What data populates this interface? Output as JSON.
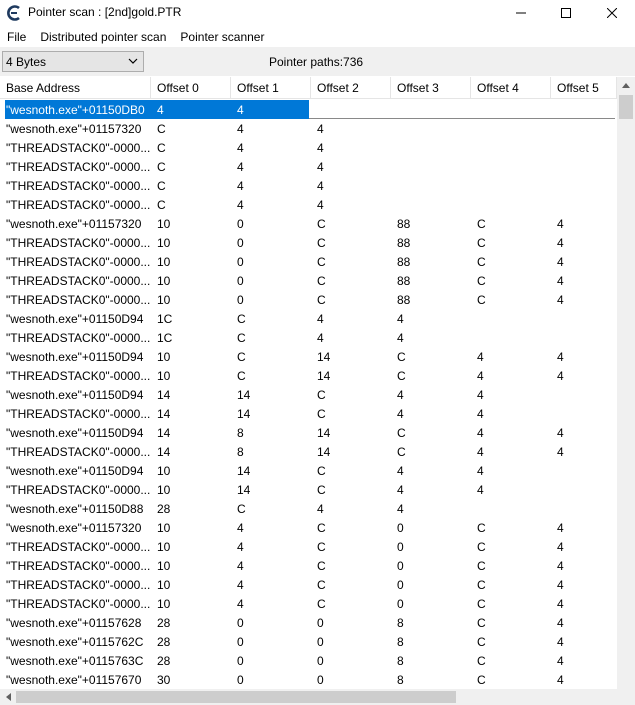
{
  "window": {
    "title": "Pointer scan : [2nd]gold.PTR",
    "minimize_glyph": "—",
    "maximize_glyph": "☐",
    "close_glyph": "✕"
  },
  "menu": [
    "File",
    "Distributed pointer scan",
    "Pointer scanner"
  ],
  "toolbar": {
    "value_type": "4 Bytes",
    "pointer_paths": "Pointer paths:736"
  },
  "table": {
    "columns": [
      "Base Address",
      "Offset 0",
      "Offset 1",
      "Offset 2",
      "Offset 3",
      "Offset 4",
      "Offset 5"
    ],
    "selected_row": 0,
    "rows": [
      [
        "\"wesnoth.exe\"+01150DB0",
        "4",
        "4",
        "",
        "",
        "",
        ""
      ],
      [
        "\"wesnoth.exe\"+01157320",
        "C",
        "4",
        "4",
        "",
        "",
        ""
      ],
      [
        "\"THREADSTACK0\"-0000...",
        "C",
        "4",
        "4",
        "",
        "",
        ""
      ],
      [
        "\"THREADSTACK0\"-0000...",
        "C",
        "4",
        "4",
        "",
        "",
        ""
      ],
      [
        "\"THREADSTACK0\"-0000...",
        "C",
        "4",
        "4",
        "",
        "",
        ""
      ],
      [
        "\"THREADSTACK0\"-0000...",
        "C",
        "4",
        "4",
        "",
        "",
        ""
      ],
      [
        "\"wesnoth.exe\"+01157320",
        "10",
        "0",
        "C",
        "88",
        "C",
        "4"
      ],
      [
        "\"THREADSTACK0\"-0000...",
        "10",
        "0",
        "C",
        "88",
        "C",
        "4"
      ],
      [
        "\"THREADSTACK0\"-0000...",
        "10",
        "0",
        "C",
        "88",
        "C",
        "4"
      ],
      [
        "\"THREADSTACK0\"-0000...",
        "10",
        "0",
        "C",
        "88",
        "C",
        "4"
      ],
      [
        "\"THREADSTACK0\"-0000...",
        "10",
        "0",
        "C",
        "88",
        "C",
        "4"
      ],
      [
        "\"wesnoth.exe\"+01150D94",
        "1C",
        "C",
        "4",
        "4",
        "",
        ""
      ],
      [
        "\"THREADSTACK0\"-0000...",
        "1C",
        "C",
        "4",
        "4",
        "",
        ""
      ],
      [
        "\"wesnoth.exe\"+01150D94",
        "10",
        "C",
        "14",
        "C",
        "4",
        "4"
      ],
      [
        "\"THREADSTACK0\"-0000...",
        "10",
        "C",
        "14",
        "C",
        "4",
        "4"
      ],
      [
        "\"wesnoth.exe\"+01150D94",
        "14",
        "14",
        "C",
        "4",
        "4",
        ""
      ],
      [
        "\"THREADSTACK0\"-0000...",
        "14",
        "14",
        "C",
        "4",
        "4",
        ""
      ],
      [
        "\"wesnoth.exe\"+01150D94",
        "14",
        "8",
        "14",
        "C",
        "4",
        "4"
      ],
      [
        "\"THREADSTACK0\"-0000...",
        "14",
        "8",
        "14",
        "C",
        "4",
        "4"
      ],
      [
        "\"wesnoth.exe\"+01150D94",
        "10",
        "14",
        "C",
        "4",
        "4",
        ""
      ],
      [
        "\"THREADSTACK0\"-0000...",
        "10",
        "14",
        "C",
        "4",
        "4",
        ""
      ],
      [
        "\"wesnoth.exe\"+01150D88",
        "28",
        "C",
        "4",
        "4",
        "",
        ""
      ],
      [
        "\"wesnoth.exe\"+01157320",
        "10",
        "4",
        "C",
        "0",
        "C",
        "4"
      ],
      [
        "\"THREADSTACK0\"-0000...",
        "10",
        "4",
        "C",
        "0",
        "C",
        "4"
      ],
      [
        "\"THREADSTACK0\"-0000...",
        "10",
        "4",
        "C",
        "0",
        "C",
        "4"
      ],
      [
        "\"THREADSTACK0\"-0000...",
        "10",
        "4",
        "C",
        "0",
        "C",
        "4"
      ],
      [
        "\"THREADSTACK0\"-0000...",
        "10",
        "4",
        "C",
        "0",
        "C",
        "4"
      ],
      [
        "\"wesnoth.exe\"+01157628",
        "28",
        "0",
        "0",
        "8",
        "C",
        "4"
      ],
      [
        "\"wesnoth.exe\"+0115762C",
        "28",
        "0",
        "0",
        "8",
        "C",
        "4"
      ],
      [
        "\"wesnoth.exe\"+0115763C",
        "28",
        "0",
        "0",
        "8",
        "C",
        "4"
      ],
      [
        "\"wesnoth.exe\"+01157670",
        "30",
        "0",
        "0",
        "8",
        "C",
        "4"
      ]
    ]
  },
  "colors": {
    "selection": "#0078d7",
    "toolbar_bg": "#f0f0f0",
    "icon_accent": "#1f3a5f"
  },
  "icons": {
    "app": "cheat-engine-icon",
    "combo": "chevron-down-icon"
  }
}
